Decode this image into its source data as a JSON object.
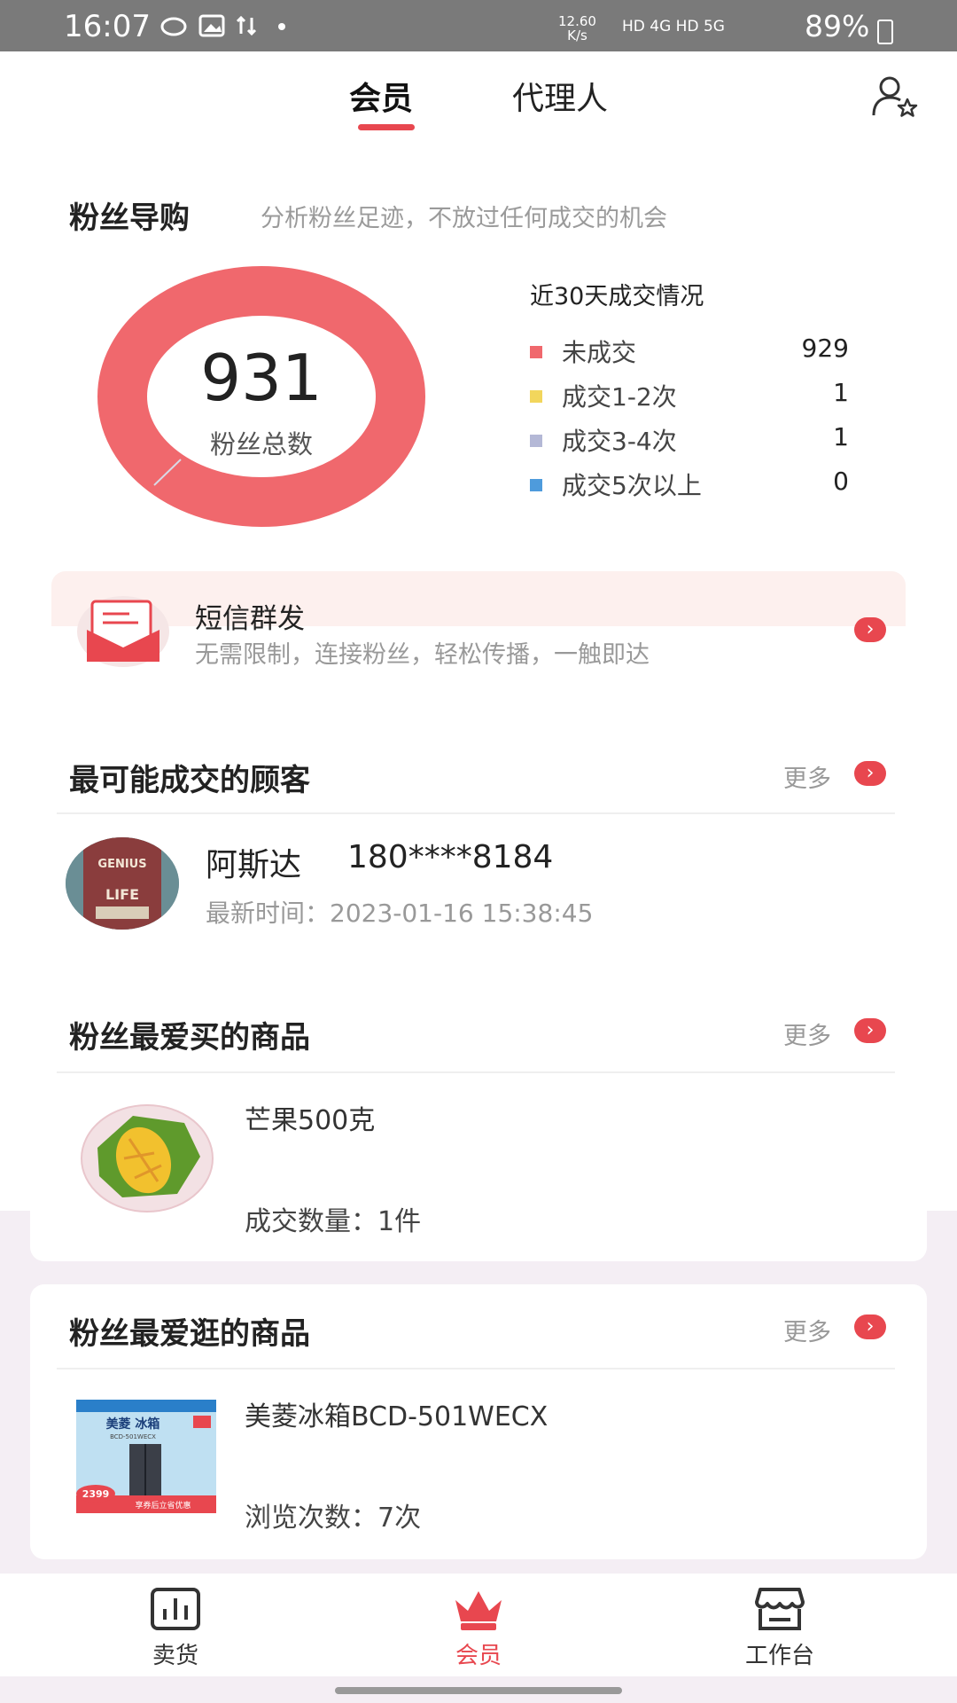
{
  "status_bar": {
    "time": "16:07",
    "speed_top": "12.60",
    "speed_bottom": "K/s",
    "network": "HD 4G HD 5G",
    "battery": "89%"
  },
  "tabs": [
    {
      "label": "会员",
      "active": true
    },
    {
      "label": "代理人",
      "active": false
    }
  ],
  "fans_guide": {
    "title": "粉丝导购",
    "subtitle": "分析粉丝足迹，不放过任何成交的机会",
    "total": "931",
    "total_label": "粉丝总数",
    "legend_title": "近30天成交情况",
    "legend": [
      {
        "label": "未成交",
        "value": "929",
        "color": "#f0686d"
      },
      {
        "label": "成交1-2次",
        "value": "1",
        "color": "#f2d65c"
      },
      {
        "label": "成交3-4次",
        "value": "1",
        "color": "#b4b8d6"
      },
      {
        "label": "成交5次以上",
        "value": "0",
        "color": "#4e9bdc"
      }
    ]
  },
  "sms": {
    "title": "短信群发",
    "desc": "无需限制，连接粉丝，轻松传播，一触即达"
  },
  "likely_customers": {
    "title": "最可能成交的顾客",
    "more": "更多",
    "customer": {
      "name": "阿斯达",
      "phone": "180****8184",
      "time": "最新时间：2023-01-16 15:38:45",
      "avatar_text": "EVERYBODY IS A GENIUS LIFE"
    }
  },
  "favorite_bought": {
    "title": "粉丝最爱买的商品",
    "more": "更多",
    "product": {
      "name": "芒果500克",
      "meta": "成交数量：1件"
    }
  },
  "favorite_browsed": {
    "title": "粉丝最爱逛的商品",
    "more": "更多",
    "product": {
      "name": "美菱冰箱BCD-501WECX",
      "meta": "浏览次数：7次"
    },
    "image_text": {
      "brand": "美菱 冰箱",
      "model": "BCD-501WECX",
      "price": "2399",
      "promo": "享券后立省优惠"
    }
  },
  "bottom_nav": [
    {
      "label": "卖货",
      "icon": "bar-chart-icon",
      "active": false
    },
    {
      "label": "会员",
      "icon": "crown-icon",
      "active": true
    },
    {
      "label": "工作台",
      "icon": "store-icon",
      "active": false
    }
  ],
  "colors": {
    "accent": "#e8474f",
    "donut": "#f0686d"
  }
}
